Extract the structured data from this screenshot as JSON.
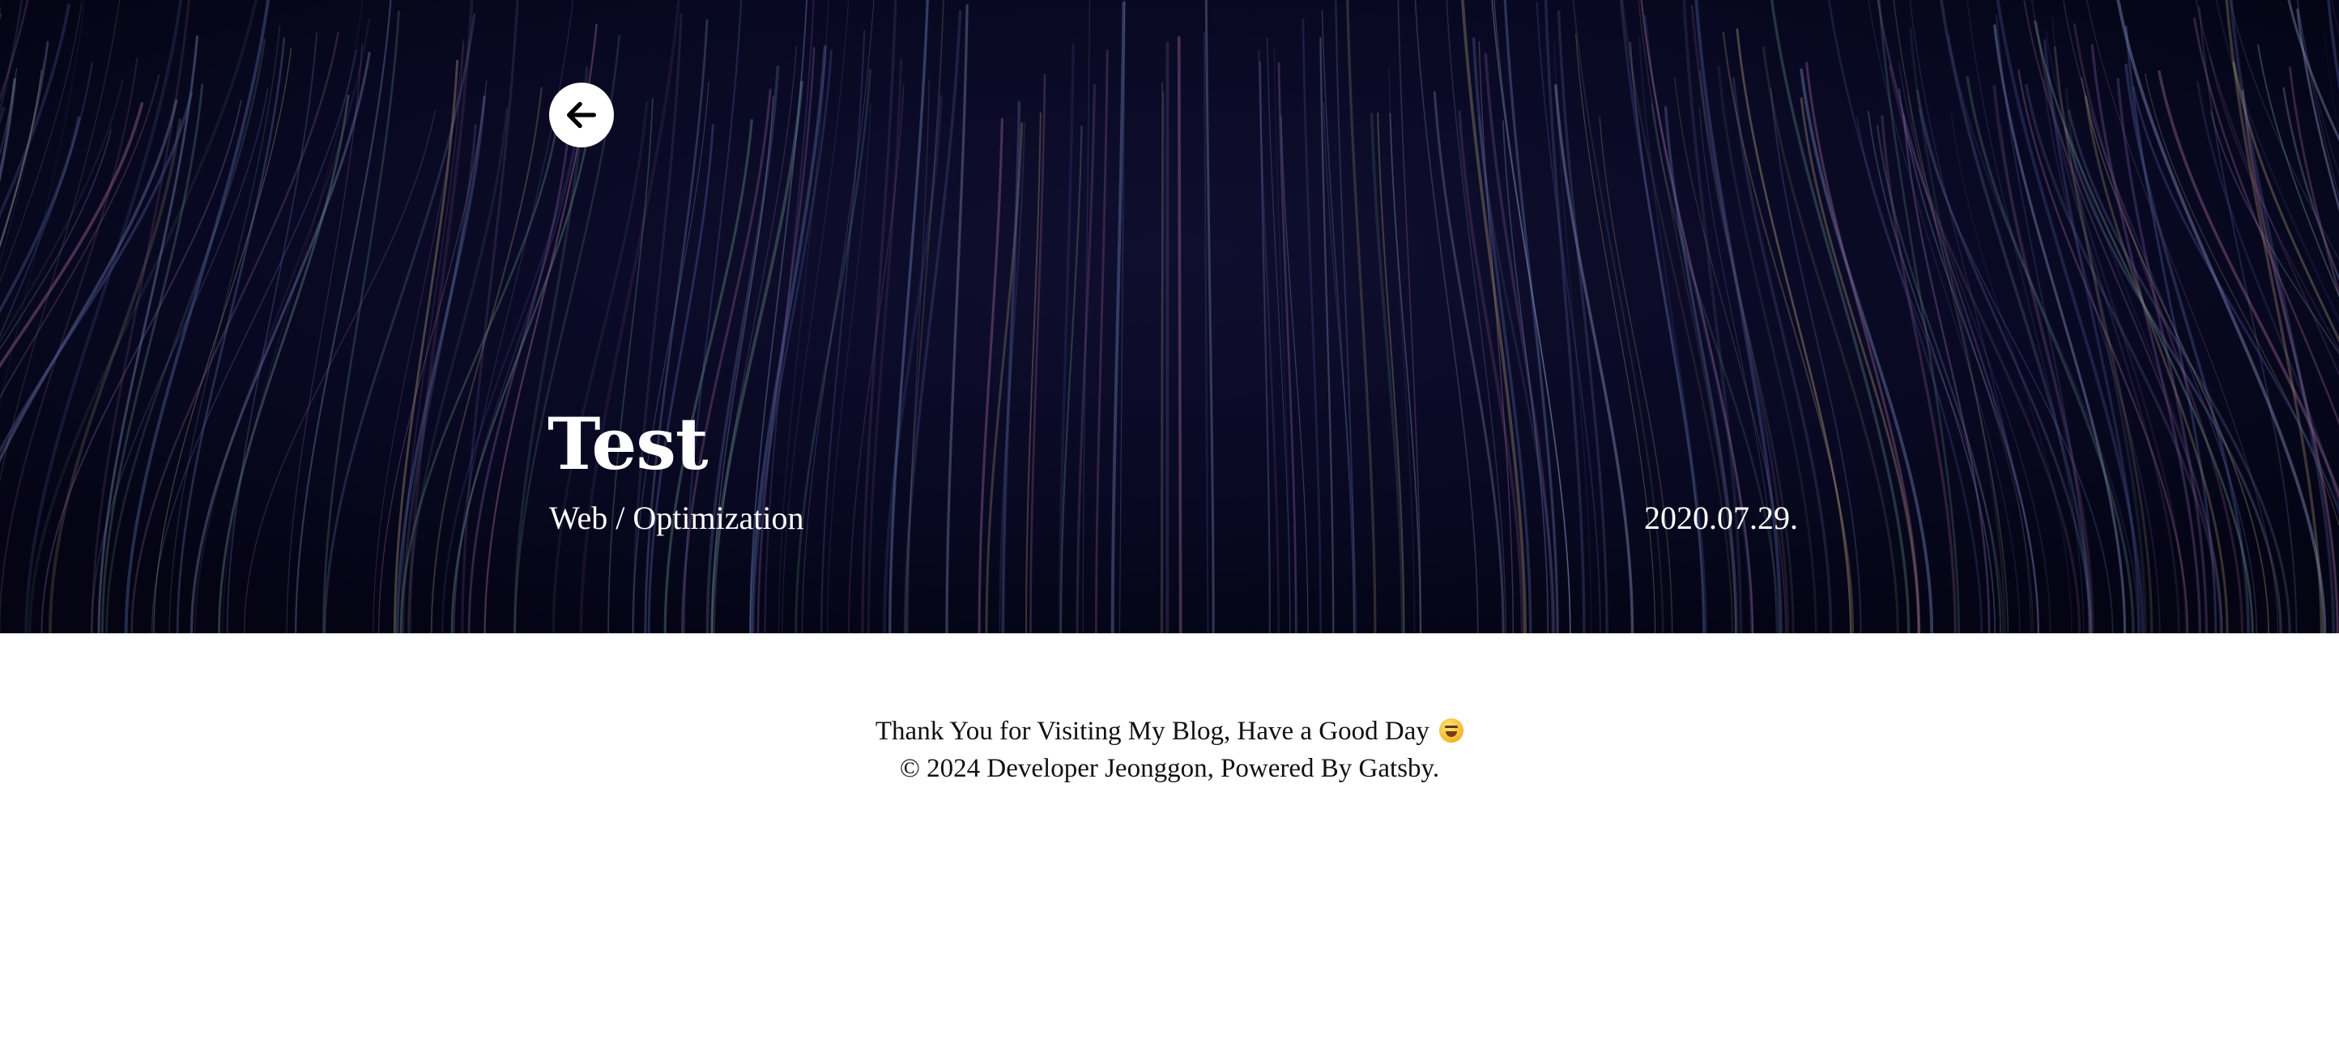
{
  "hero": {
    "back_icon": "arrow-left-icon",
    "title": "Test",
    "category": "Web / Optimization",
    "date": "2020.07.29."
  },
  "footer": {
    "line1": "Thank You for Visiting My Blog, Have a Good Day",
    "line1_emoji": "grinning-squinting-face-icon",
    "line2": "© 2024 Developer Jeonggon, Powered By Gatsby."
  },
  "colors": {
    "hero_background": "#06061a",
    "hero_text": "#ffffff",
    "footer_text": "#111111",
    "page_background": "#ffffff"
  }
}
